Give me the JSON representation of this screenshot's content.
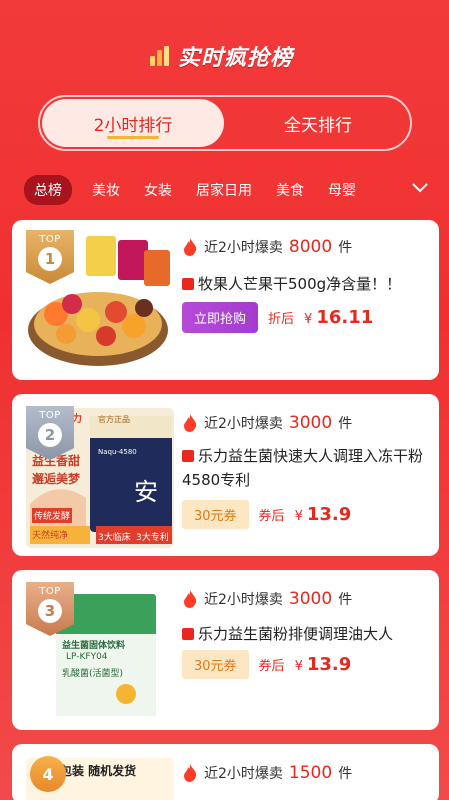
{
  "header": {
    "title": "实时疯抢榜",
    "tabs": [
      {
        "label": "2小时排行",
        "active": true
      },
      {
        "label": "全天排行",
        "active": false
      }
    ]
  },
  "categories": [
    "总榜",
    "美妆",
    "女装",
    "居家日用",
    "美食",
    "母婴"
  ],
  "colors": {
    "accent": "#e8281f",
    "bg": "#f23a3a",
    "gold": "#f5b431",
    "buy_button": "#b64bd8",
    "coupon_bg": "#fde6c2"
  },
  "products": [
    {
      "rank_top": "TOP",
      "rank": "1",
      "sales_prefix": "近2小时爆卖",
      "sales_count": "8000",
      "sales_unit": "件",
      "name": "牧果人芒果干500g净含量！！",
      "action": "立即抢购",
      "price_label": "折后",
      "currency": "¥",
      "price": "16.11"
    },
    {
      "rank_top": "TOP",
      "rank": "2",
      "sales_prefix": "近2小时爆卖",
      "sales_count": "3000",
      "sales_unit": "件",
      "name": "乐力益生菌快速大人调理入冻干粉4580专利",
      "coupon": "30元券",
      "price_label": "券后",
      "currency": "¥",
      "price": "13.9",
      "thumb_texts": [
        "乐力",
        "官方正品",
        "益生香甜",
        "邂逅美梦",
        "Naqu-4580",
        "安",
        "传统发酵",
        "天然纯净",
        "3大临床",
        "3大专利"
      ]
    },
    {
      "rank_top": "TOP",
      "rank": "3",
      "sales_prefix": "近2小时爆卖",
      "sales_count": "3000",
      "sales_unit": "件",
      "name": "乐力益生菌粉排便调理油大人B420",
      "coupon": "30元券",
      "price_label": "券后",
      "currency": "¥",
      "price": "13.9",
      "thumb_texts": [
        "益生菌固体饮料",
        "LP-KFY04",
        "乳酸菌(活菌型)"
      ]
    },
    {
      "rank": "4",
      "sales_prefix": "近2小时爆卖",
      "sales_count": "1500",
      "sales_unit": "件",
      "thumb_texts": [
        "包装 随机发货"
      ]
    }
  ]
}
